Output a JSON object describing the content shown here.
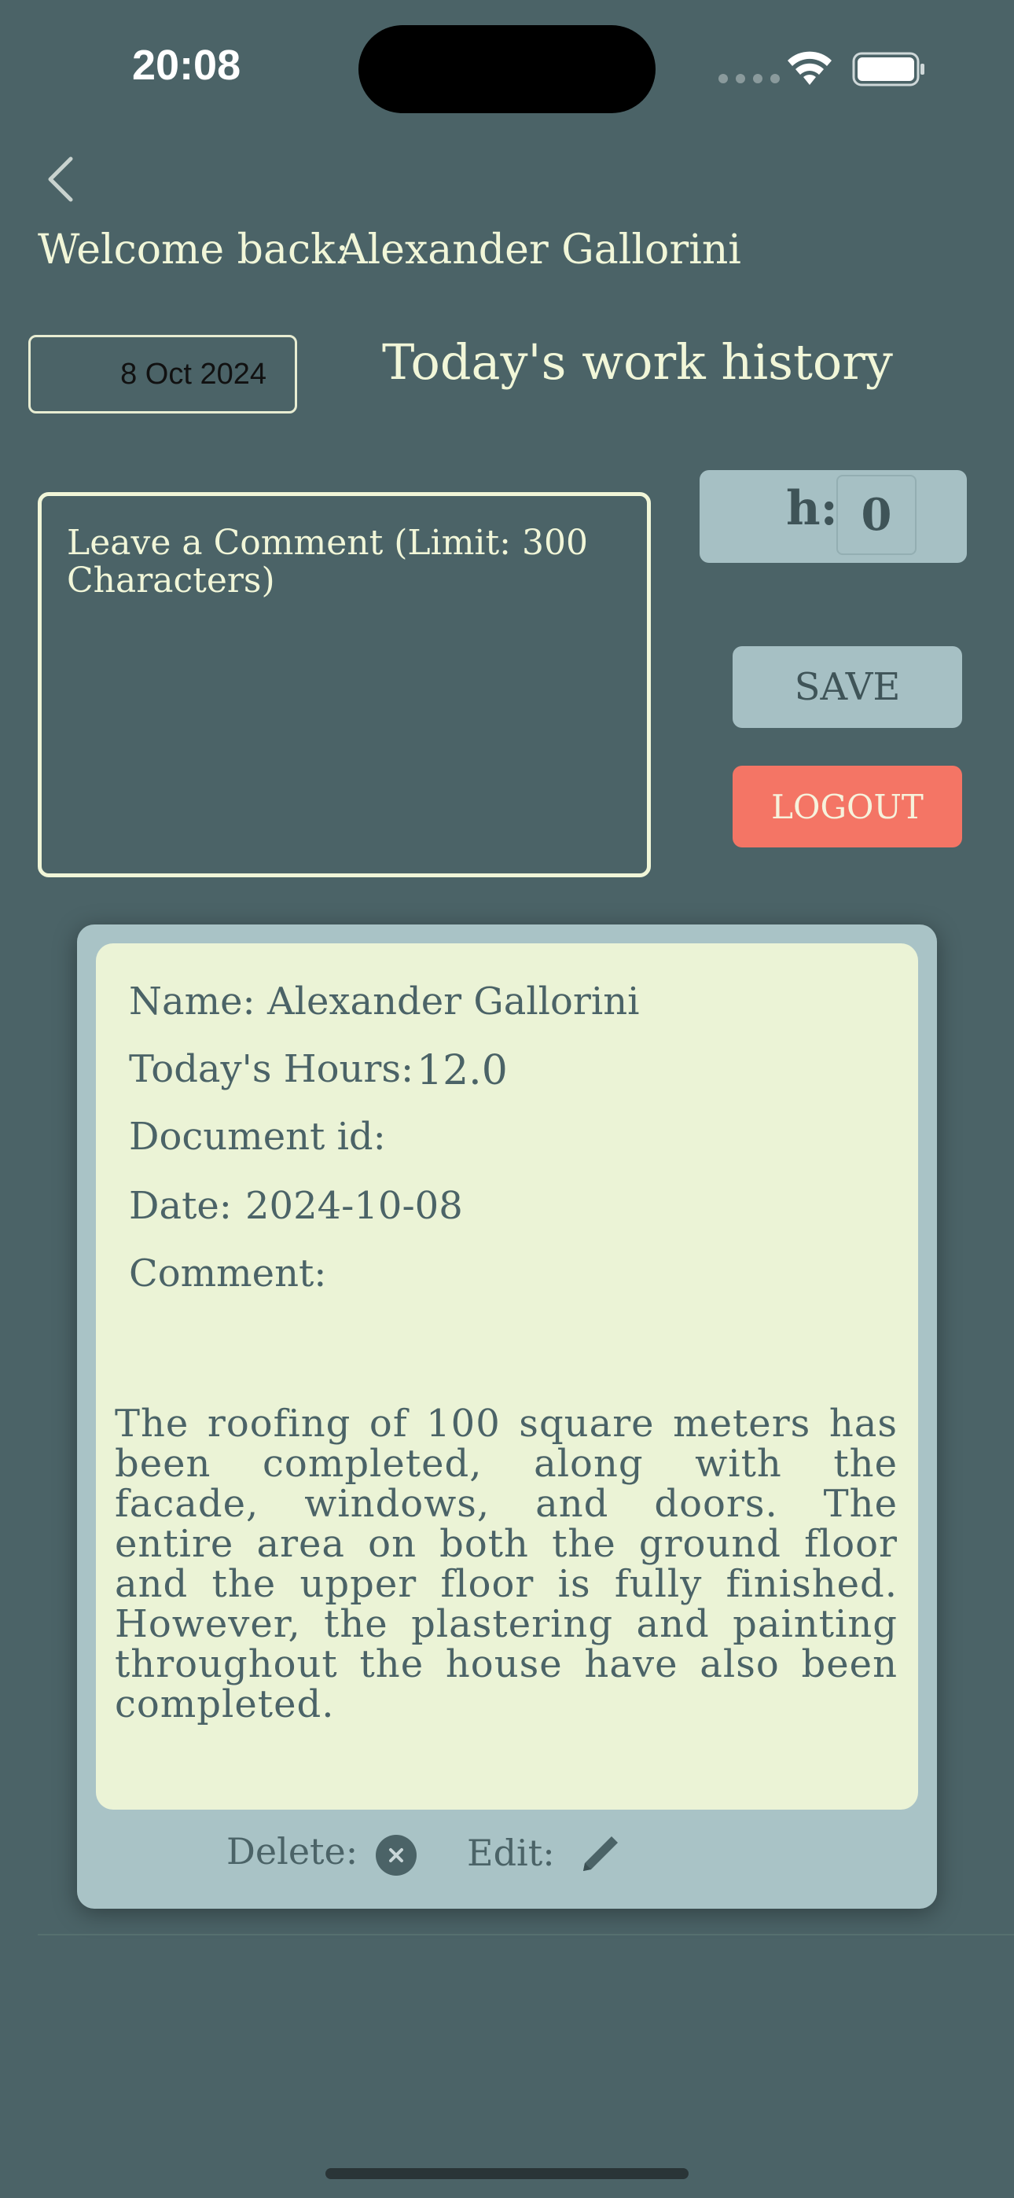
{
  "status_bar": {
    "time": "20:08",
    "icons": [
      "cellular-signal-icon",
      "wifi-icon",
      "battery-icon"
    ]
  },
  "header": {
    "back_icon": "chevron-left-icon",
    "welcome_label": "Welcome back:",
    "user_name": "Alexander Gallorini"
  },
  "date_picker": {
    "value": "8 Oct 2024"
  },
  "page_title": "Today's work history",
  "comment_input": {
    "placeholder": "Leave a Comment (Limit: 300 Characters)",
    "value": ""
  },
  "hours_input": {
    "label": "h:",
    "value": "0"
  },
  "buttons": {
    "save": "SAVE",
    "logout": "LOGOUT"
  },
  "record_card": {
    "name_label": "Name:",
    "name_value": "Alexander Gallorini",
    "hours_label": "Today's Hours:",
    "hours_value": "12.0",
    "document_id_label": "Document id:",
    "date_label": "Date:",
    "date_value": "2024-10-08",
    "comment_label": "Comment:",
    "comment_text": "The roofing of 100 square meters has been completed, along with the facade, windows, and doors. The entire area on both the ground floor and the upper floor is fully finished. However, the plastering and painting throughout the house have also been completed.",
    "delete_label": "Delete:",
    "edit_label": "Edit:",
    "delete_icon": "close-circle-icon",
    "edit_icon": "pencil-icon"
  },
  "colors": {
    "background": "#4b6367",
    "accent_light": "#f1f6d8",
    "card_outer": "#a9c3c6",
    "card_inner": "#ebf3d6",
    "logout": "#f47565",
    "button": "#a6c0c4"
  }
}
